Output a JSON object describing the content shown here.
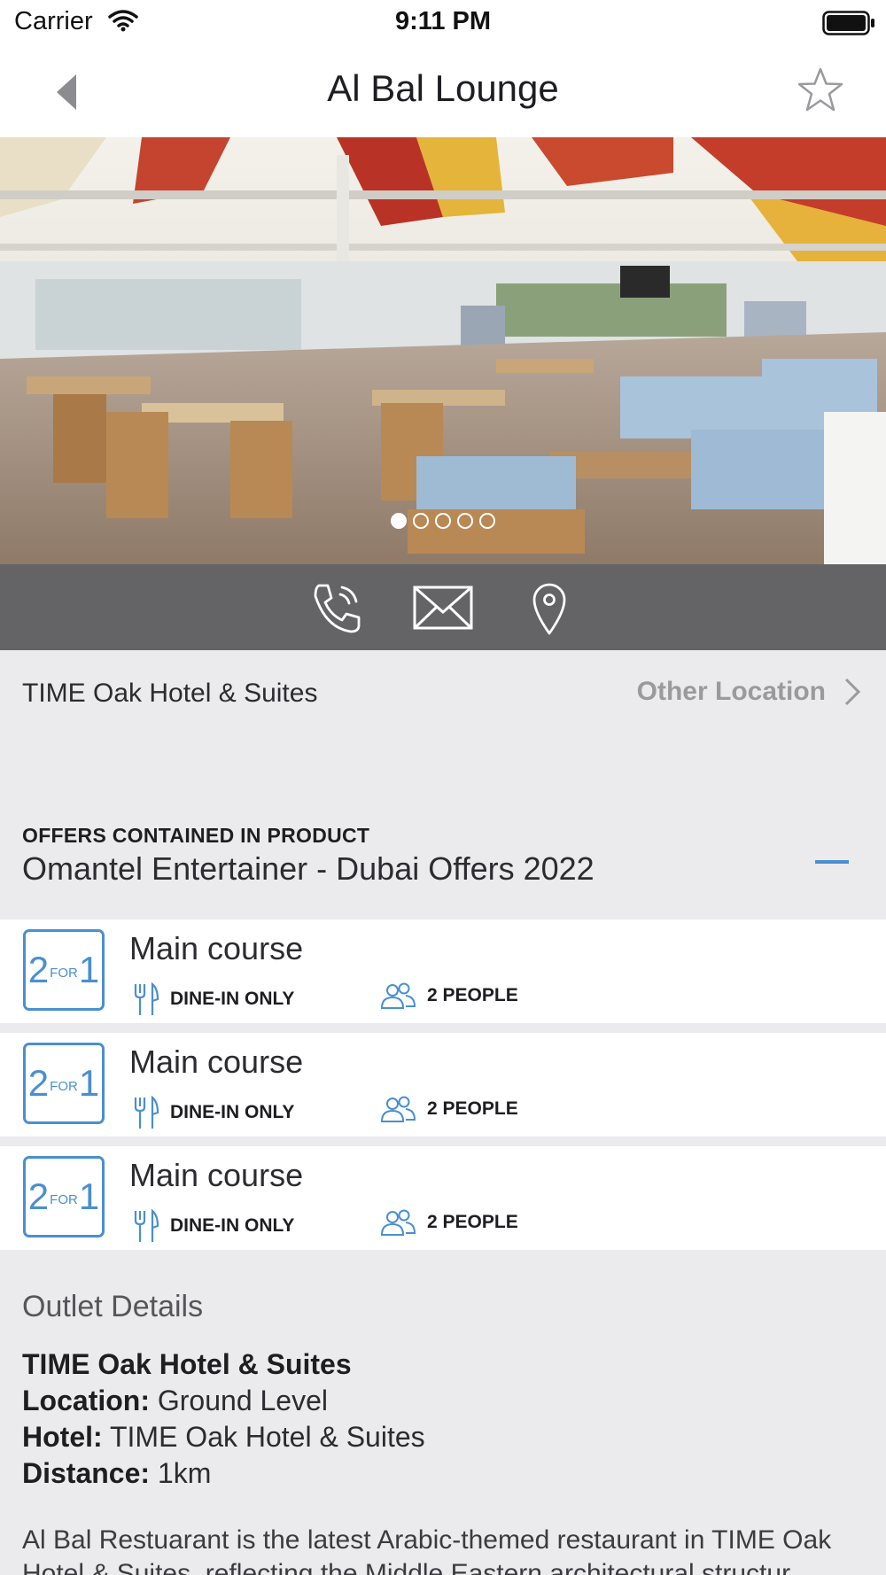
{
  "status_bar": {
    "carrier": "Carrier",
    "time": "9:11 PM"
  },
  "header": {
    "title": "Al Bal Lounge"
  },
  "gallery": {
    "page_count": 5,
    "current_page": 1
  },
  "actions": {
    "call_icon": "phone-icon",
    "email_icon": "mail-icon",
    "map_icon": "map-pin-icon"
  },
  "location": {
    "hotel": "TIME Oak Hotel & Suites",
    "other_label": "Other Location"
  },
  "offers": {
    "caption": "OFFERS CONTAINED IN PRODUCT",
    "product": "Omantel Entertainer  - Dubai Offers 2022",
    "items": [
      {
        "badge_left": "2",
        "badge_mid": "FOR",
        "badge_right": "1",
        "title": "Main course",
        "dine": "DINE-IN ONLY",
        "people": "2 PEOPLE"
      },
      {
        "badge_left": "2",
        "badge_mid": "FOR",
        "badge_right": "1",
        "title": "Main course",
        "dine": "DINE-IN ONLY",
        "people": "2 PEOPLE"
      },
      {
        "badge_left": "2",
        "badge_mid": "FOR",
        "badge_right": "1",
        "title": "Main course",
        "dine": "DINE-IN ONLY",
        "people": "2 PEOPLE"
      }
    ]
  },
  "outlet": {
    "section_title": "Outlet Details",
    "name": "TIME Oak Hotel & Suites",
    "location_label": "Location:",
    "location_value": " Ground Level",
    "hotel_label": "Hotel:",
    "hotel_value": " TIME Oak Hotel & Suites",
    "distance_label": "Distance:",
    "distance_value": " 1km",
    "description": "Al Bal Restuarant is the latest Arabic-themed restaurant in TIME Oak Hotel & Suites, reflecting the Middle Eastern architectural structur"
  },
  "colors": {
    "accent": "#4a8fcf",
    "action_bar": "#646466",
    "background": "#ebebee"
  }
}
